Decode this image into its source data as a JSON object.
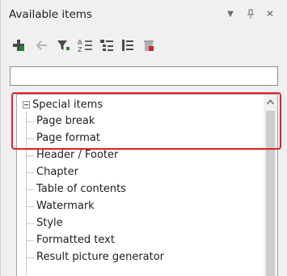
{
  "panel": {
    "title": "Available items",
    "controls": {
      "menu_glyph": "▼",
      "pin_glyph": "⍑",
      "close_glyph": "✕"
    }
  },
  "toolbar": {
    "buttons": [
      {
        "name": "add-icon"
      },
      {
        "name": "back-arrow-icon"
      },
      {
        "name": "filter-icon"
      },
      {
        "name": "sort-az-icon"
      },
      {
        "name": "outline-icon"
      },
      {
        "name": "list-icon"
      },
      {
        "name": "delete-icon"
      }
    ]
  },
  "search": {
    "value": "",
    "placeholder": ""
  },
  "tree": {
    "root": {
      "label": "Special items",
      "expanded": true
    },
    "children": [
      {
        "label": "Page break"
      },
      {
        "label": "Page format"
      },
      {
        "label": "Header / Footer"
      },
      {
        "label": "Chapter"
      },
      {
        "label": "Table of contents"
      },
      {
        "label": "Watermark"
      },
      {
        "label": "Style"
      },
      {
        "label": "Formatted text"
      },
      {
        "label": "Result picture generator"
      }
    ]
  },
  "colors": {
    "highlight": "#e32128",
    "accent_green": "#2e7d32",
    "accent_red": "#c62828"
  }
}
